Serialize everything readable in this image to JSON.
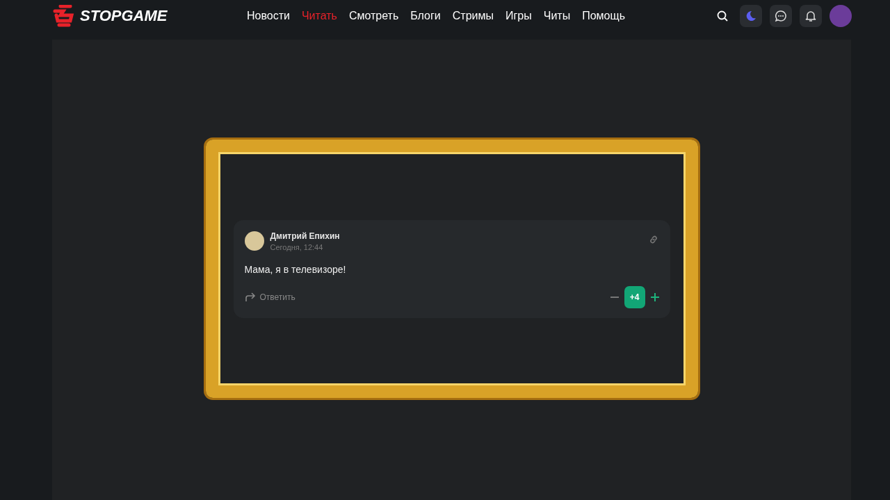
{
  "header": {
    "logo": "STOPGAME",
    "nav": [
      {
        "label": "Новости",
        "selected": false
      },
      {
        "label": "Читать",
        "selected": true
      },
      {
        "label": "Смотреть",
        "selected": false
      },
      {
        "label": "Блоги",
        "selected": false
      },
      {
        "label": "Стримы",
        "selected": false
      },
      {
        "label": "Игры",
        "selected": false
      },
      {
        "label": "Читы",
        "selected": false
      },
      {
        "label": "Помощь",
        "selected": false
      }
    ]
  },
  "comment": {
    "author": "Дмитрий Епихин",
    "time": "Сегодня, 12:44",
    "text": "Мама, я в телевизоре!",
    "reply": "Ответить",
    "rating": "+4"
  }
}
